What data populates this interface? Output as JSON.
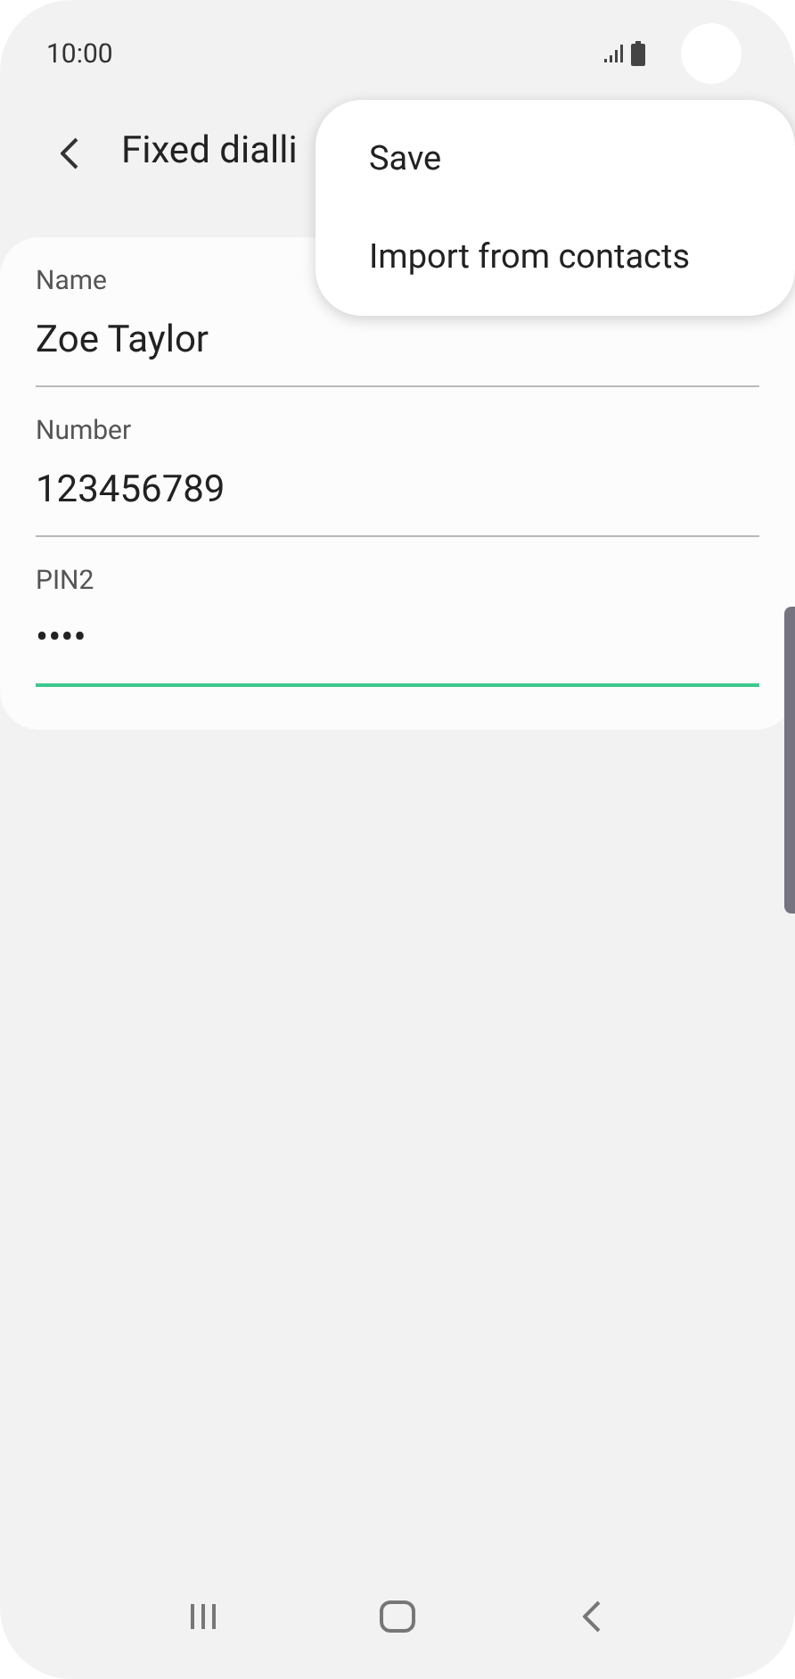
{
  "status_bar": {
    "time": "10:00"
  },
  "header": {
    "title": "Fixed dialli"
  },
  "fields": [
    {
      "label": "Name",
      "value": "Zoe Taylor",
      "focused": false
    },
    {
      "label": "Number",
      "value": "123456789",
      "focused": false
    },
    {
      "label": "PIN2",
      "value": "••••",
      "focused": true
    }
  ],
  "menu": {
    "items": [
      "Save",
      "Import from contacts"
    ]
  }
}
